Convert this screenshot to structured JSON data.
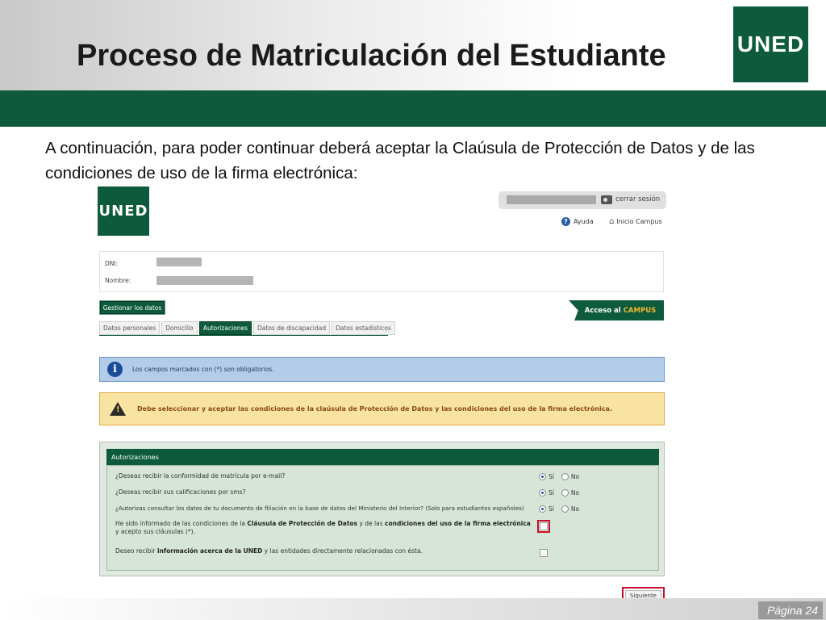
{
  "slide": {
    "title": "Proceso de Matriculación del Estudiante",
    "logo_text": "UNED",
    "intro": "A continuación, para poder continuar deberá aceptar la Claúsula de Protección de Datos y de las condiciones de uso de la firma electrónica:",
    "page_label": "Página 24"
  },
  "screenshot": {
    "logo_text": "UNED",
    "header": {
      "logout": "cerrar sesión",
      "help": "Ayuda",
      "home": "Inicio Campus"
    },
    "person": {
      "dni_label": "DNI:",
      "name_label": "Nombre:"
    },
    "manage_button": "Gestionar los datos",
    "campus_button_prefix": "Acceso al",
    "campus_button_accent": "CAMPUS",
    "tabs": [
      {
        "label": "Datos personales",
        "active": false
      },
      {
        "label": "Domicilio",
        "active": false
      },
      {
        "label": "Autorizaciones",
        "active": true
      },
      {
        "label": "Datos de discapacidad",
        "active": false
      },
      {
        "label": "Datos estadísticos",
        "active": false
      }
    ],
    "info_message": "Los campos marcados con (*) son obligatorios.",
    "warning_message": "Debe seleccionar y aceptar las condiciones de la claúsula de Protección de Datos y las condiciones del uso de la firma electrónica.",
    "authorizations": {
      "title": "Autorizaciones",
      "yes": "Sí",
      "no": "No",
      "q1": "¿Deseas recibir la conformidad de matrícula por e-mail?",
      "q2": "¿Deseas recibir sus calificaciones por sms?",
      "q3": "¿Autorizas consultar los datos de tu documento de filiación en la base de datos del Ministerio del Interior? (Solo para estudiantes españoles)",
      "q4_a": "He sido informado de las condiciones de la ",
      "q4_b": "Cláusula de Protección de Datos",
      "q4_c": " y de las ",
      "q4_d": "condiciones del uso de la firma electrónica",
      "q4_e": " y acepto sus cláusulas (*).",
      "q5_a": "Deseo recibir ",
      "q5_b": "información acerca de la UNED",
      "q5_c": " y las entidades directamente relacionadas con ésta."
    },
    "next_button": "Siguiente",
    "accent_color": "#0d5b3c",
    "highlight_color": "#c8102e"
  }
}
